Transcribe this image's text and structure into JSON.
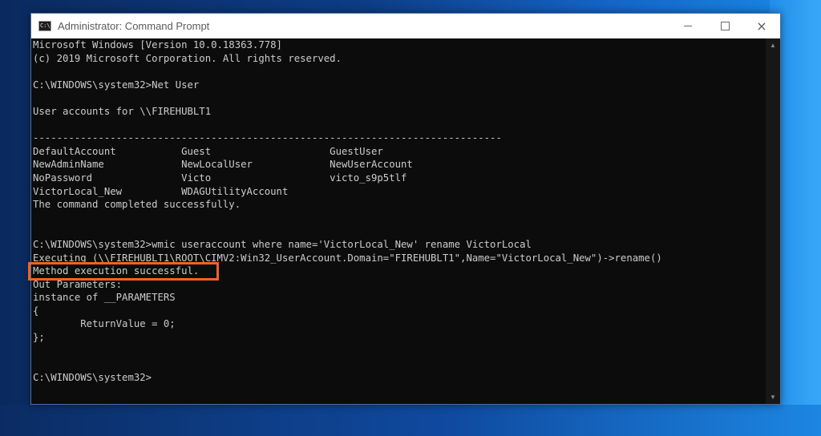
{
  "window": {
    "title": "Administrator: Command Prompt",
    "icon_text": "C:\\",
    "controls": {
      "minimize": "minimize-icon",
      "maximize": "maximize-icon",
      "close": "×"
    }
  },
  "console": {
    "lines": [
      "Microsoft Windows [Version 10.0.18363.778]",
      "(c) 2019 Microsoft Corporation. All rights reserved.",
      "",
      "C:\\WINDOWS\\system32>Net User",
      "",
      "User accounts for \\\\FIREHUBLT1",
      "",
      "-------------------------------------------------------------------------------",
      "DefaultAccount           Guest                    GuestUser",
      "NewAdminName             NewLocalUser             NewUserAccount",
      "NoPassword               Victo                    victo_s9p5tlf",
      "VictorLocal_New          WDAGUtilityAccount",
      "The command completed successfully.",
      "",
      "",
      "C:\\WINDOWS\\system32>wmic useraccount where name='VictorLocal_New' rename VictorLocal",
      "Executing (\\\\FIREHUBLT1\\ROOT\\CIMV2:Win32_UserAccount.Domain=\"FIREHUBLT1\",Name=\"VictorLocal_New\")->rename()",
      "Method execution successful.",
      "Out Parameters:",
      "instance of __PARAMETERS",
      "{",
      "        ReturnValue = 0;",
      "};",
      "",
      "",
      "C:\\WINDOWS\\system32>"
    ]
  },
  "scrollbar": {
    "up_arrow": "▲",
    "down_arrow": "▼"
  },
  "colors": {
    "console_bg": "#0c0c0c",
    "console_text": "#cccccc",
    "highlight": "#f26322"
  }
}
